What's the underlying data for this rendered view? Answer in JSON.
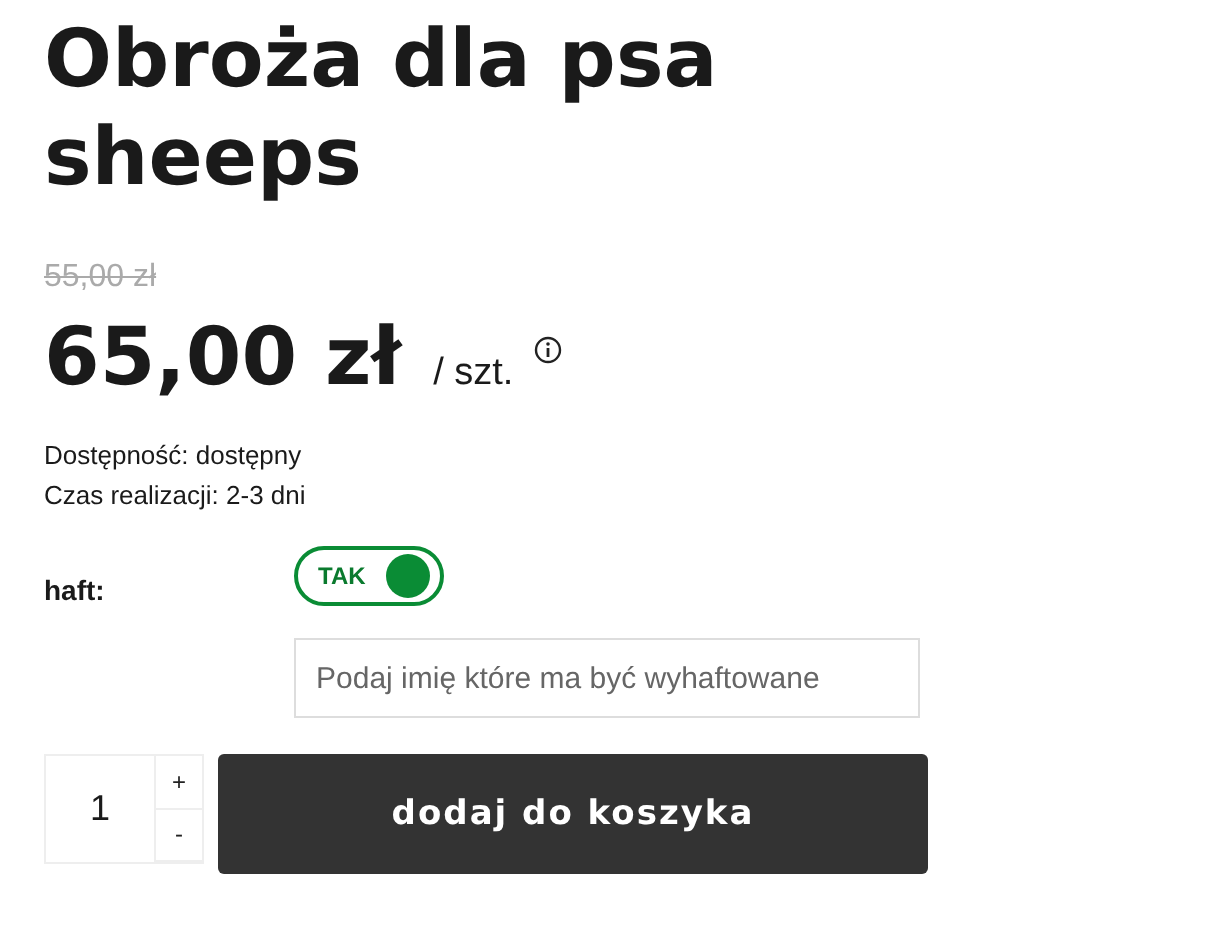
{
  "product": {
    "title": "Obroża dla psa sheeps"
  },
  "price": {
    "old": "55,00 zł",
    "current": "65,00 zł",
    "unit": "/ szt."
  },
  "availability": [
    "Dostępność: dostępny",
    "Czas realizacji: 2-3 dni"
  ],
  "option": {
    "label": "haft:",
    "toggle": {
      "text": "TAK",
      "on": true
    },
    "field": {
      "placeholder": "Podaj imię które ma być wyhaftowane"
    }
  },
  "quantity": {
    "value": "1",
    "plus": "+",
    "minus": "-"
  },
  "cart_button": "dodaj do koszyka"
}
